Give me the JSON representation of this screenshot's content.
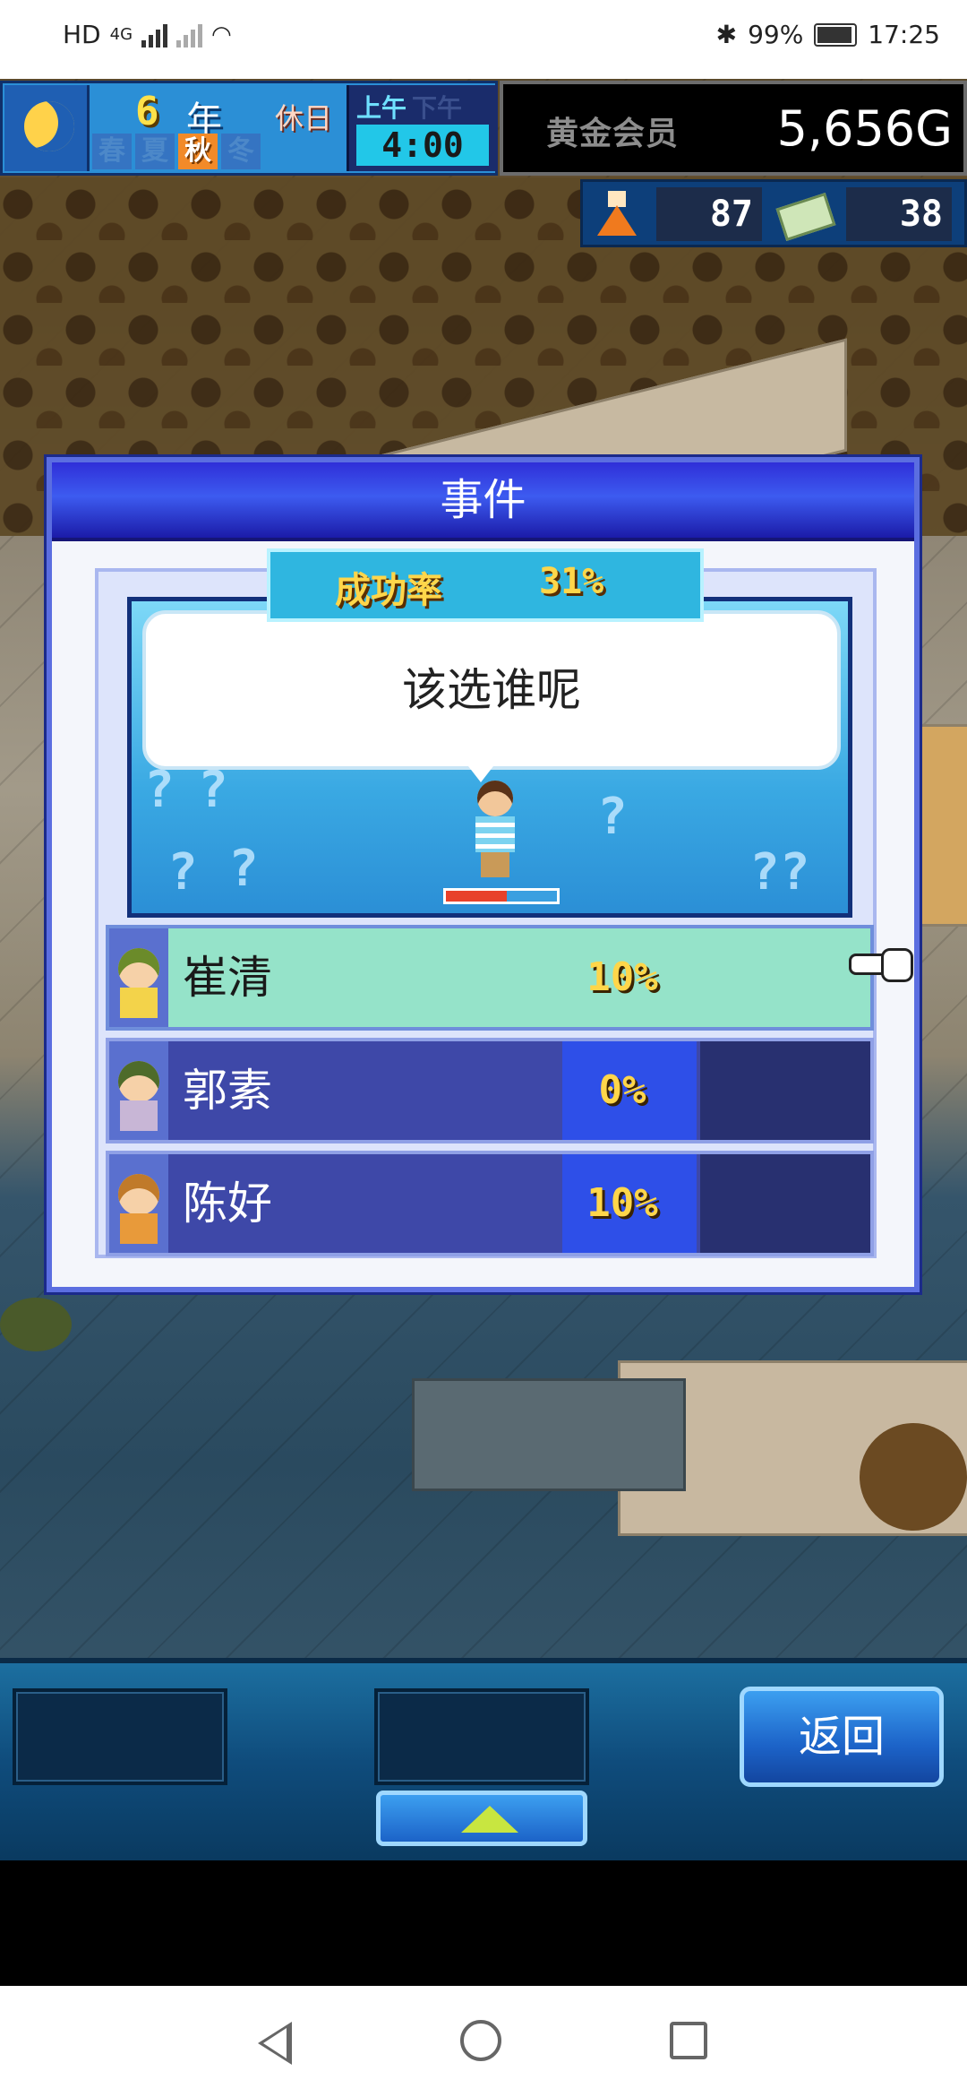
{
  "status_bar": {
    "network": "HD",
    "signal_label": "4G",
    "battery": "99%",
    "time": "17:25"
  },
  "hud": {
    "year_number": "6",
    "year_label": "年",
    "holiday_label": "休日",
    "seasons": [
      "春",
      "夏",
      "秋",
      "冬"
    ],
    "active_season": "秋",
    "am_label": "上午",
    "pm_label": "下午",
    "clock": "4:00",
    "member_label": "黄金会员",
    "gold": "5,656G",
    "research_points": "87",
    "tickets": "38"
  },
  "dialog": {
    "title": "事件",
    "success_label": "成功率",
    "success_value": "31%",
    "speech": "该选谁呢",
    "hp_fraction": 0.55,
    "candidates": [
      {
        "name": "崔清",
        "pct": "10%",
        "selected": true
      },
      {
        "name": "郭素",
        "pct": "0%",
        "selected": false
      },
      {
        "name": "陈好",
        "pct": "10%",
        "selected": false
      }
    ]
  },
  "bottom": {
    "back_label": "返回"
  },
  "colors": {
    "dialog_title_bar": "#2f2fd8",
    "selected_row": "#95e3c9",
    "row_bg": "#3e48a8",
    "percent_text": "#ffd64a"
  },
  "icons": {
    "moon": "night-moon-icon",
    "flask": "flask-icon",
    "ticket": "ticket-icon",
    "pointer": "hand-pointer-icon",
    "up": "up-arrow-icon"
  }
}
